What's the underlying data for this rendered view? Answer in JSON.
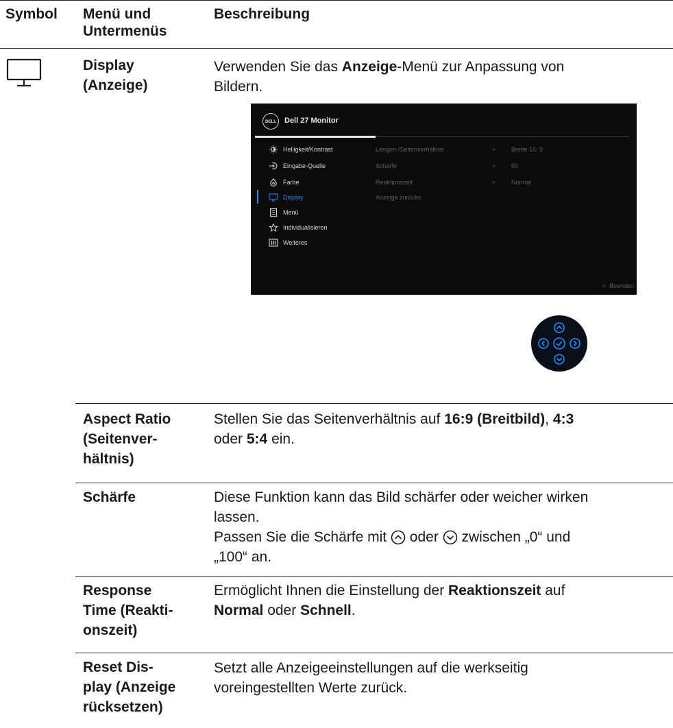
{
  "headers": {
    "symbol": "Symbol",
    "menu_line1": "Menü und",
    "menu_line2": "Untermenüs",
    "description": "Beschreibung"
  },
  "display_section": {
    "icon": "monitor-icon",
    "name_line1": "Display",
    "name_line2": "(Anzeige)",
    "desc": {
      "prefix": "Verwenden Sie das ",
      "bold": "Anzeige",
      "line1_suffix": "-Menü zur Anpassung von",
      "line2": "Bildern."
    }
  },
  "osd": {
    "logo": "DELL",
    "title": "Dell 27 Monitor",
    "menu_items": [
      {
        "label": "Helligkeit/Kontrast",
        "icon": "brightness-icon",
        "active": false
      },
      {
        "label": "Eingabe-Quelle",
        "icon": "input-source-icon",
        "active": false
      },
      {
        "label": "Farbe",
        "icon": "color-icon",
        "active": false
      },
      {
        "label": "Display",
        "icon": "display-icon",
        "active": true
      },
      {
        "label": "Menü",
        "icon": "menu-icon",
        "active": false
      },
      {
        "label": "Individualisieren",
        "icon": "star-icon",
        "active": false
      },
      {
        "label": "Weiteres",
        "icon": "others-icon",
        "active": false
      }
    ],
    "submenu": [
      {
        "label": "Längen-/Seitenverhältnis",
        "arrow": ">",
        "value": "Breite 16: 9"
      },
      {
        "label": "Schärfe",
        "arrow": ">",
        "value": "50"
      },
      {
        "label": "Reaktionszeit",
        "arrow": ">",
        "value": "Normal"
      },
      {
        "label": "Anzeige zurücks.",
        "arrow": "",
        "value": ""
      }
    ],
    "exit_label": "Beenden",
    "exit_arrow": "<"
  },
  "joystick": {
    "icon": "joystick-icon"
  },
  "rows": {
    "aspect": {
      "name_lines": [
        "Aspect Ratio",
        "(Seitenver-",
        "hältnis)"
      ],
      "d1": "Stellen Sie das Seitenverhältnis auf ",
      "b1": "16:9 (Breitbild)",
      "d2": ", ",
      "b2": "4:3",
      "d3": "oder ",
      "b3": "5:4",
      "d4": " ein."
    },
    "sharpness": {
      "name": "Schärfe",
      "line1": "Diese Funktion kann das Bild schärfer oder weicher wirken",
      "line2": "lassen.",
      "line3a": "Passen Sie die Schärfe mit ",
      "line3b": " oder ",
      "line3c": " zwischen „0“ und",
      "line4": "„100“ an."
    },
    "response": {
      "name_lines": [
        "Response",
        "Time (Reakti-",
        "onszeit)"
      ],
      "l1a": "Ermöglicht Ihnen die Einstellung der ",
      "l1b": "Reaktionszeit",
      "l1c": " auf",
      "l2a": "Normal",
      "l2b": " oder ",
      "l2c": "Schnell",
      "l2d": "."
    },
    "reset": {
      "name_lines": [
        "Reset Dis-",
        "play (Anzeige",
        "rücksetzen)"
      ],
      "line1": "Setzt alle Anzeigeeinstellungen auf die werkseitig",
      "line2": "voreingestellten Werte zurück."
    }
  },
  "colors": {
    "osd_bg": "#0b0b0b",
    "accent_blue": "#2f86d8",
    "joystick_ring": "#1e90ff"
  }
}
